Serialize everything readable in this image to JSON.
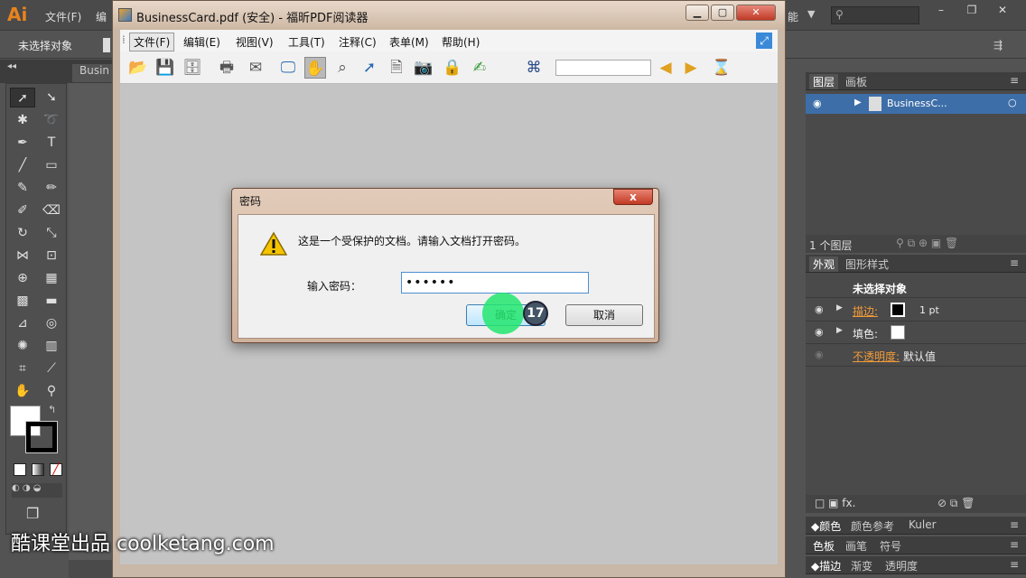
{
  "ai": {
    "logo": "Ai",
    "menus": [
      "文件(F)",
      "编"
    ],
    "menu_right": "能",
    "control_label": "未选择对象",
    "doc_tab": "Busin"
  },
  "pdf": {
    "title": "BusinessCard.pdf (安全) - 福昕PDF阅读器",
    "menus": [
      "文件(F)",
      "编辑(E)",
      "视图(V)",
      "工具(T)",
      "注释(C)",
      "表单(M)",
      "帮助(H)"
    ]
  },
  "dialog": {
    "title": "密码",
    "close": "x",
    "message": "这是一个受保护的文档。请输入文档打开密码。",
    "password_label": "输入密码：",
    "password_value": "••••••",
    "ok": "确定",
    "cancel": "取消",
    "step": "17"
  },
  "layers": {
    "tabs": [
      "图层",
      "画板"
    ],
    "layer_name": "BusinessC...",
    "count": "1 个图层"
  },
  "appearance": {
    "tabs": [
      "外观",
      "图形样式"
    ],
    "header": "未选择对象",
    "stroke_label": "描边:",
    "stroke_value": "1 pt",
    "fill_label": "填色:",
    "opacity_label": "不透明度:",
    "opacity_value": "默认值"
  },
  "color_panels": {
    "row1": [
      "颜色",
      "颜色参考",
      "Kuler"
    ],
    "row2": [
      "色板",
      "画笔",
      "符号"
    ],
    "row3": [
      "描边",
      "渐变",
      "透明度"
    ]
  },
  "watermark": "酷课堂出品 coolketang.com",
  "colors": {
    "accent_orange": "#f29b38",
    "selected_layer": "#3d6ea8",
    "click_marker": "#22e66e"
  }
}
